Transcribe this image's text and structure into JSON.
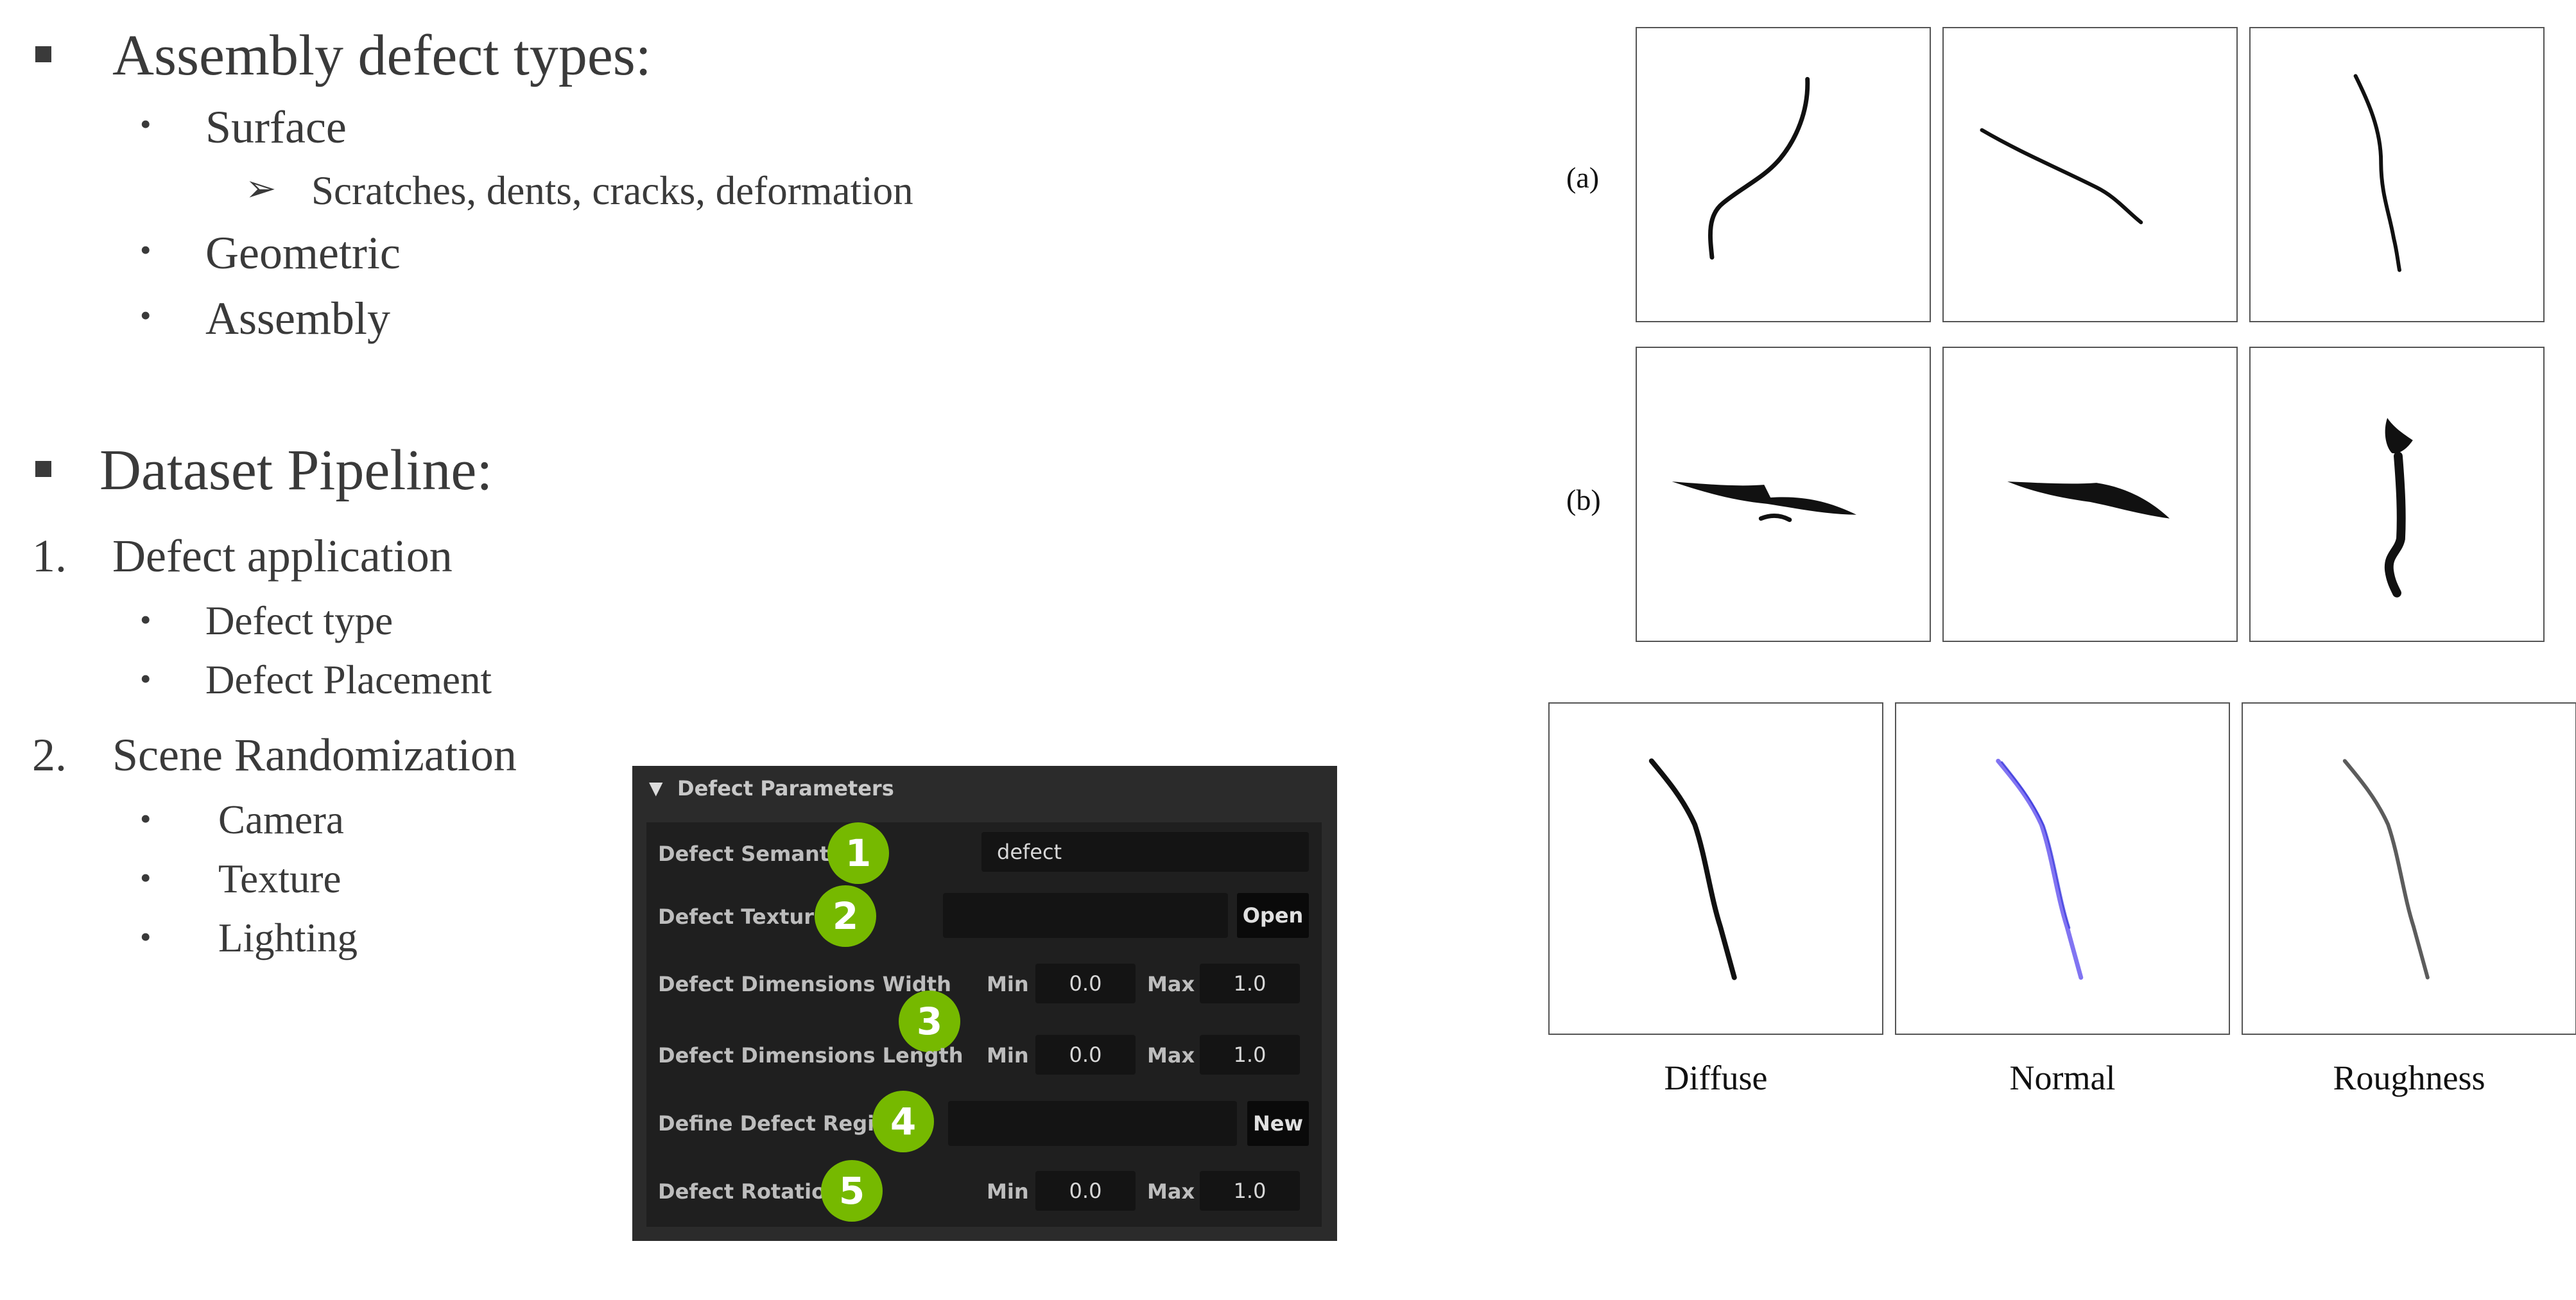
{
  "section1": {
    "heading": "Assembly defect types:",
    "items": [
      "Surface",
      "Geometric",
      "Assembly"
    ],
    "surface_sub": "Scratches, dents, cracks, deformation"
  },
  "section2": {
    "heading": "Dataset Pipeline:",
    "step1": {
      "number": "1.",
      "label": "Defect application",
      "items": [
        "Defect type",
        "Defect Placement"
      ]
    },
    "step2": {
      "number": "2.",
      "label": "Scene Randomization",
      "items": [
        "Camera",
        "Texture",
        "Lighting"
      ]
    }
  },
  "panel": {
    "title": "Defect Parameters",
    "rows": [
      {
        "label": "Defect Semantic",
        "badge": "1",
        "value": "defect"
      },
      {
        "label": "Defect Texture",
        "badge": "2",
        "value": "",
        "button": "Open"
      },
      {
        "label": "Defect Dimensions Width",
        "badge": "3",
        "min_label": "Min",
        "min": "0.0",
        "max_label": "Max",
        "max": "1.0"
      },
      {
        "label": "Defect Dimensions Length",
        "min_label": "Min",
        "min": "0.0",
        "max_label": "Max",
        "max": "1.0"
      },
      {
        "label": "Define Defect Region",
        "badge": "4",
        "value": "",
        "button": "New"
      },
      {
        "label": "Defect Rotation",
        "badge": "5",
        "min_label": "Min",
        "min": "0.0",
        "max_label": "Max",
        "max": "1.0"
      }
    ]
  },
  "figure": {
    "row_a_label": "(a)",
    "row_b_label": "(b)",
    "captions": [
      "Diffuse",
      "Normal",
      "Roughness"
    ]
  }
}
